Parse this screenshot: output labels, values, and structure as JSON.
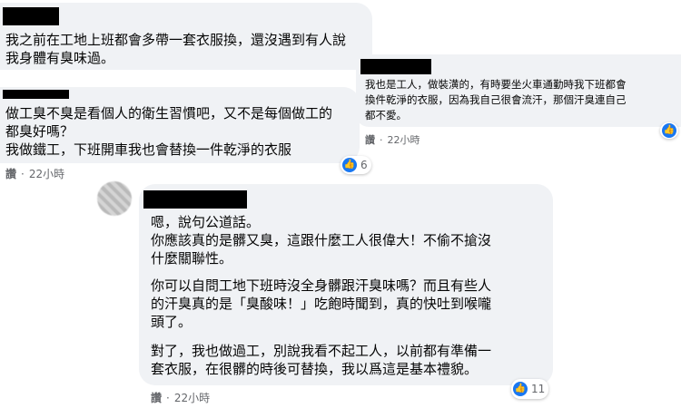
{
  "comment1": {
    "lines": [
      "我之前在工地上班都會多帶一套衣服換，還沒遇到有人說",
      "我身體有臭味過。"
    ]
  },
  "comment2": {
    "lines": [
      "我也是工人，做裝潢的，有時要坐火車通勤時我下班都會",
      "換件乾淨的衣服，因為我自己很會流汗，那個汗臭連自己",
      "都不愛。"
    ],
    "action": "讚",
    "time": "22小時",
    "like_icon": "like-icon"
  },
  "comment3": {
    "lines": [
      "做工臭不臭是看個人的衛生習慣吧，又不是每個做工的",
      "都臭好嗎？",
      "我做鐵工，下班開車我也會替換一件乾淨的衣服"
    ],
    "action": "讚",
    "time": "22小時",
    "reaction_count": "6",
    "like_icon": "like-icon"
  },
  "comment4": {
    "para1": [
      "嗯，說句公道話。",
      "你應該真的是髒又臭，這跟什麼工人很偉大！不偷不搶沒",
      "什麼關聯性。"
    ],
    "para2": [
      "你可以自問工地下班時沒全身髒跟汗臭味嗎？而且有些人",
      "的汗臭真的是「臭酸味！」吃飽時聞到，真的快吐到喉嚨",
      "頭了。"
    ],
    "para3": [
      "對了，我也做過工，別說我看不起工人，以前都有準備一",
      "套衣服，在很髒的時後可替換，我以爲這是基本禮貌。"
    ],
    "action": "讚",
    "time": "22小時",
    "reaction_count": "11",
    "like_icon": "like-icon"
  }
}
